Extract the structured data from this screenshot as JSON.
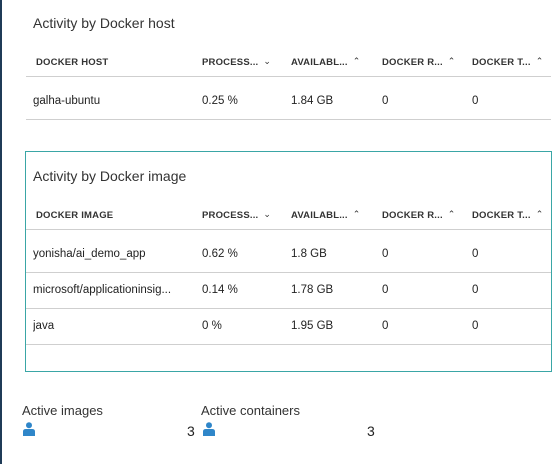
{
  "host_tile": {
    "title": "Activity by Docker host",
    "columns": [
      {
        "label": "DOCKER HOST",
        "sort": ""
      },
      {
        "label": "PROCESS...",
        "sort": "chevron-down"
      },
      {
        "label": "AVAILABL...",
        "sort": "chevron-up"
      },
      {
        "label": "DOCKER R...",
        "sort": "chevron-up"
      },
      {
        "label": "DOCKER T...",
        "sort": "chevron-up"
      }
    ],
    "rows": [
      [
        "galha-ubuntu",
        "0.25 %",
        "1.84 GB",
        "0",
        "0"
      ]
    ]
  },
  "image_tile": {
    "title": "Activity by Docker image",
    "columns": [
      {
        "label": "DOCKER IMAGE",
        "sort": ""
      },
      {
        "label": "PROCESS...",
        "sort": "chevron-down"
      },
      {
        "label": "AVAILABL...",
        "sort": "chevron-up"
      },
      {
        "label": "DOCKER R...",
        "sort": "chevron-up"
      },
      {
        "label": "DOCKER T...",
        "sort": "chevron-up"
      }
    ],
    "rows": [
      [
        "yonisha/ai_demo_app",
        "0.62 %",
        "1.8 GB",
        "0",
        "0"
      ],
      [
        "microsoft/applicationinsig...",
        "0.14 %",
        "1.78 GB",
        "0",
        "0"
      ],
      [
        "java",
        "0 %",
        "1.95 GB",
        "0",
        "0"
      ]
    ]
  },
  "summary": {
    "active_images_label": "Active images",
    "active_images_value": "3",
    "active_containers_label": "Active containers",
    "active_containers_value": "3",
    "icon": "person-icon"
  },
  "colors": {
    "accent": "#3aa6a6",
    "icon": "#2f86c9",
    "left_rule": "#1f3b57"
  }
}
